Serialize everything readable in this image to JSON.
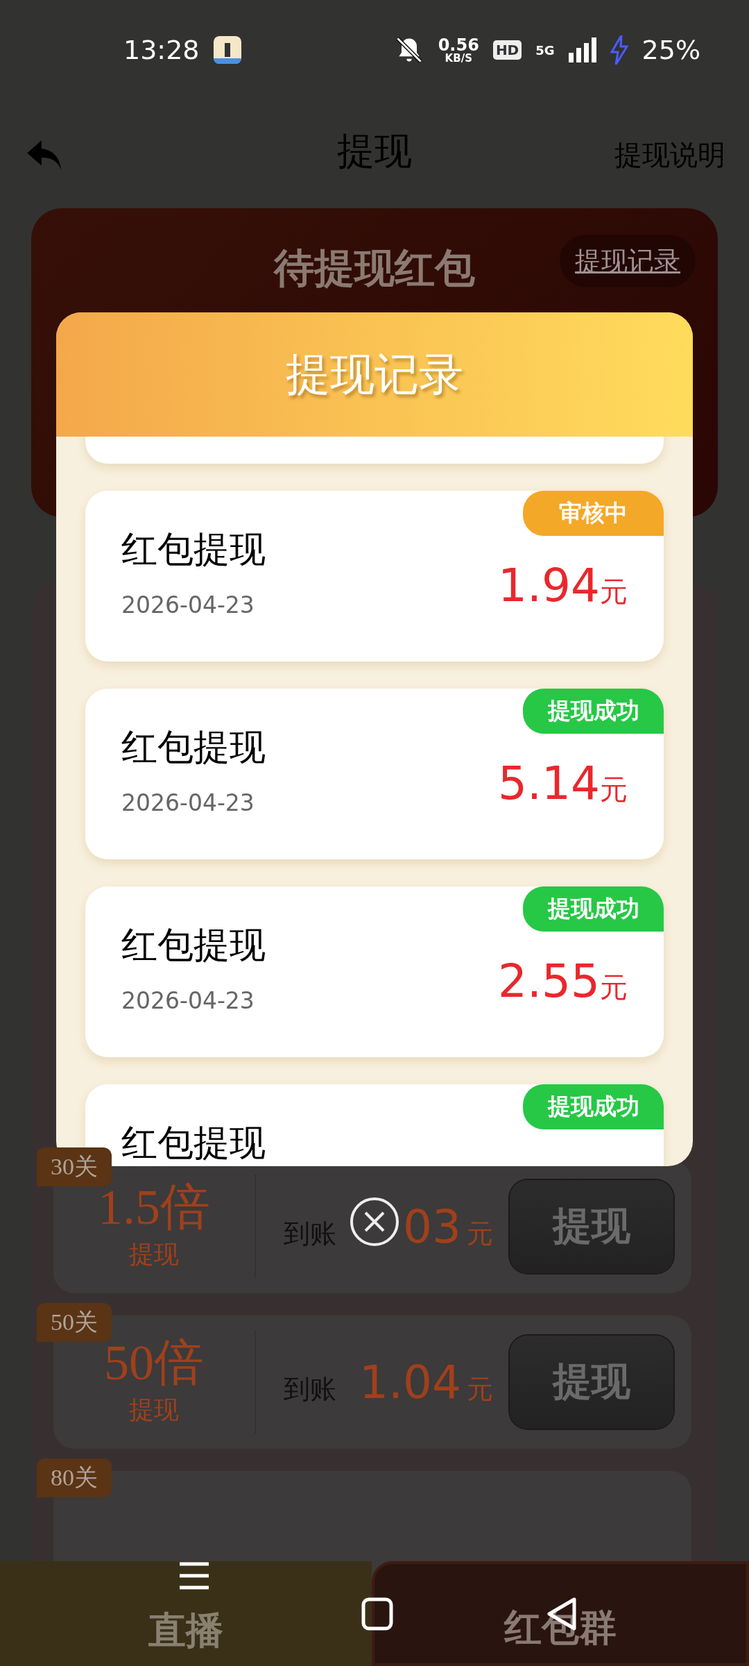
{
  "status_bar": {
    "time": "13:28",
    "net_speed": "0.56",
    "net_unit": "KB/S",
    "hd": "HD",
    "network": "5G",
    "battery": "25%"
  },
  "header": {
    "title": "提现",
    "help_link": "提现说明"
  },
  "pending_card": {
    "title": "待提现红包",
    "records_button": "提现记录"
  },
  "tiers": [
    {
      "level": "30关",
      "multiplier": "1.5倍",
      "caption": "提现",
      "credit_label": "到账",
      "amount": "03",
      "unit": "元",
      "button": "提现"
    },
    {
      "level": "50关",
      "multiplier": "50倍",
      "caption": "提现",
      "credit_label": "到账",
      "amount": "1.04",
      "unit": "元",
      "button": "提现"
    },
    {
      "level": "80关"
    }
  ],
  "bottom_tabs": [
    {
      "label": "直播",
      "kind": "live"
    },
    {
      "label": "红包群",
      "kind": "group"
    }
  ],
  "dialog": {
    "title": "提现记录",
    "records": [
      {
        "kind": "clipped"
      },
      {
        "kind": "record",
        "title": "红包提现",
        "date": "2026-04-23",
        "amount": "1.94",
        "unit": "元",
        "status": "审核中",
        "color": "#f4a828"
      },
      {
        "kind": "record",
        "title": "红包提现",
        "date": "2026-04-23",
        "amount": "5.14",
        "unit": "元",
        "status": "提现成功",
        "color": "#26c846"
      },
      {
        "kind": "record",
        "title": "红包提现",
        "date": "2026-04-23",
        "amount": "2.55",
        "unit": "元",
        "status": "提现成功",
        "color": "#26c846"
      },
      {
        "kind": "record",
        "title": "红包提现",
        "status": "提现成功",
        "color": "#26c846"
      }
    ]
  }
}
